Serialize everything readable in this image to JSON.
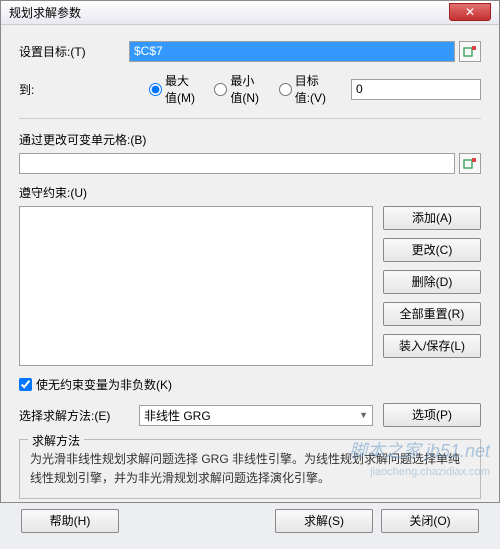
{
  "title": "规划求解参数",
  "labels": {
    "set_objective": "设置目标:(T)",
    "to": "到:",
    "max": "最大值(M)",
    "min": "最小值(N)",
    "value_of": "目标值:(V)",
    "by_changing": "通过更改可变单元格:(B)",
    "subject_to": "遵守约束:(U)",
    "make_nonneg": "使无约束变量为非负数(K)",
    "select_method": "选择求解方法:(E)",
    "method_box_title": "求解方法",
    "method_desc": "为光滑非线性规划求解问题选择 GRG 非线性引擎。为线性规划求解问题选择单纯线性规划引擎，并为非光滑规划求解问题选择演化引擎。"
  },
  "values": {
    "objective": "$C$7",
    "to_value": "0",
    "radio_selected": "max",
    "nonneg_checked": true,
    "method_selected": "非线性 GRG"
  },
  "buttons": {
    "add": "添加(A)",
    "change": "更改(C)",
    "delete": "删除(D)",
    "reset_all": "全部重置(R)",
    "load_save": "装入/保存(L)",
    "options": "选项(P)",
    "help": "帮助(H)",
    "solve": "求解(S)",
    "close": "关闭(O)"
  },
  "watermark": {
    "main": "脚本之家 jb51.net",
    "sub": "jiaocheng.chazidiax.com"
  }
}
